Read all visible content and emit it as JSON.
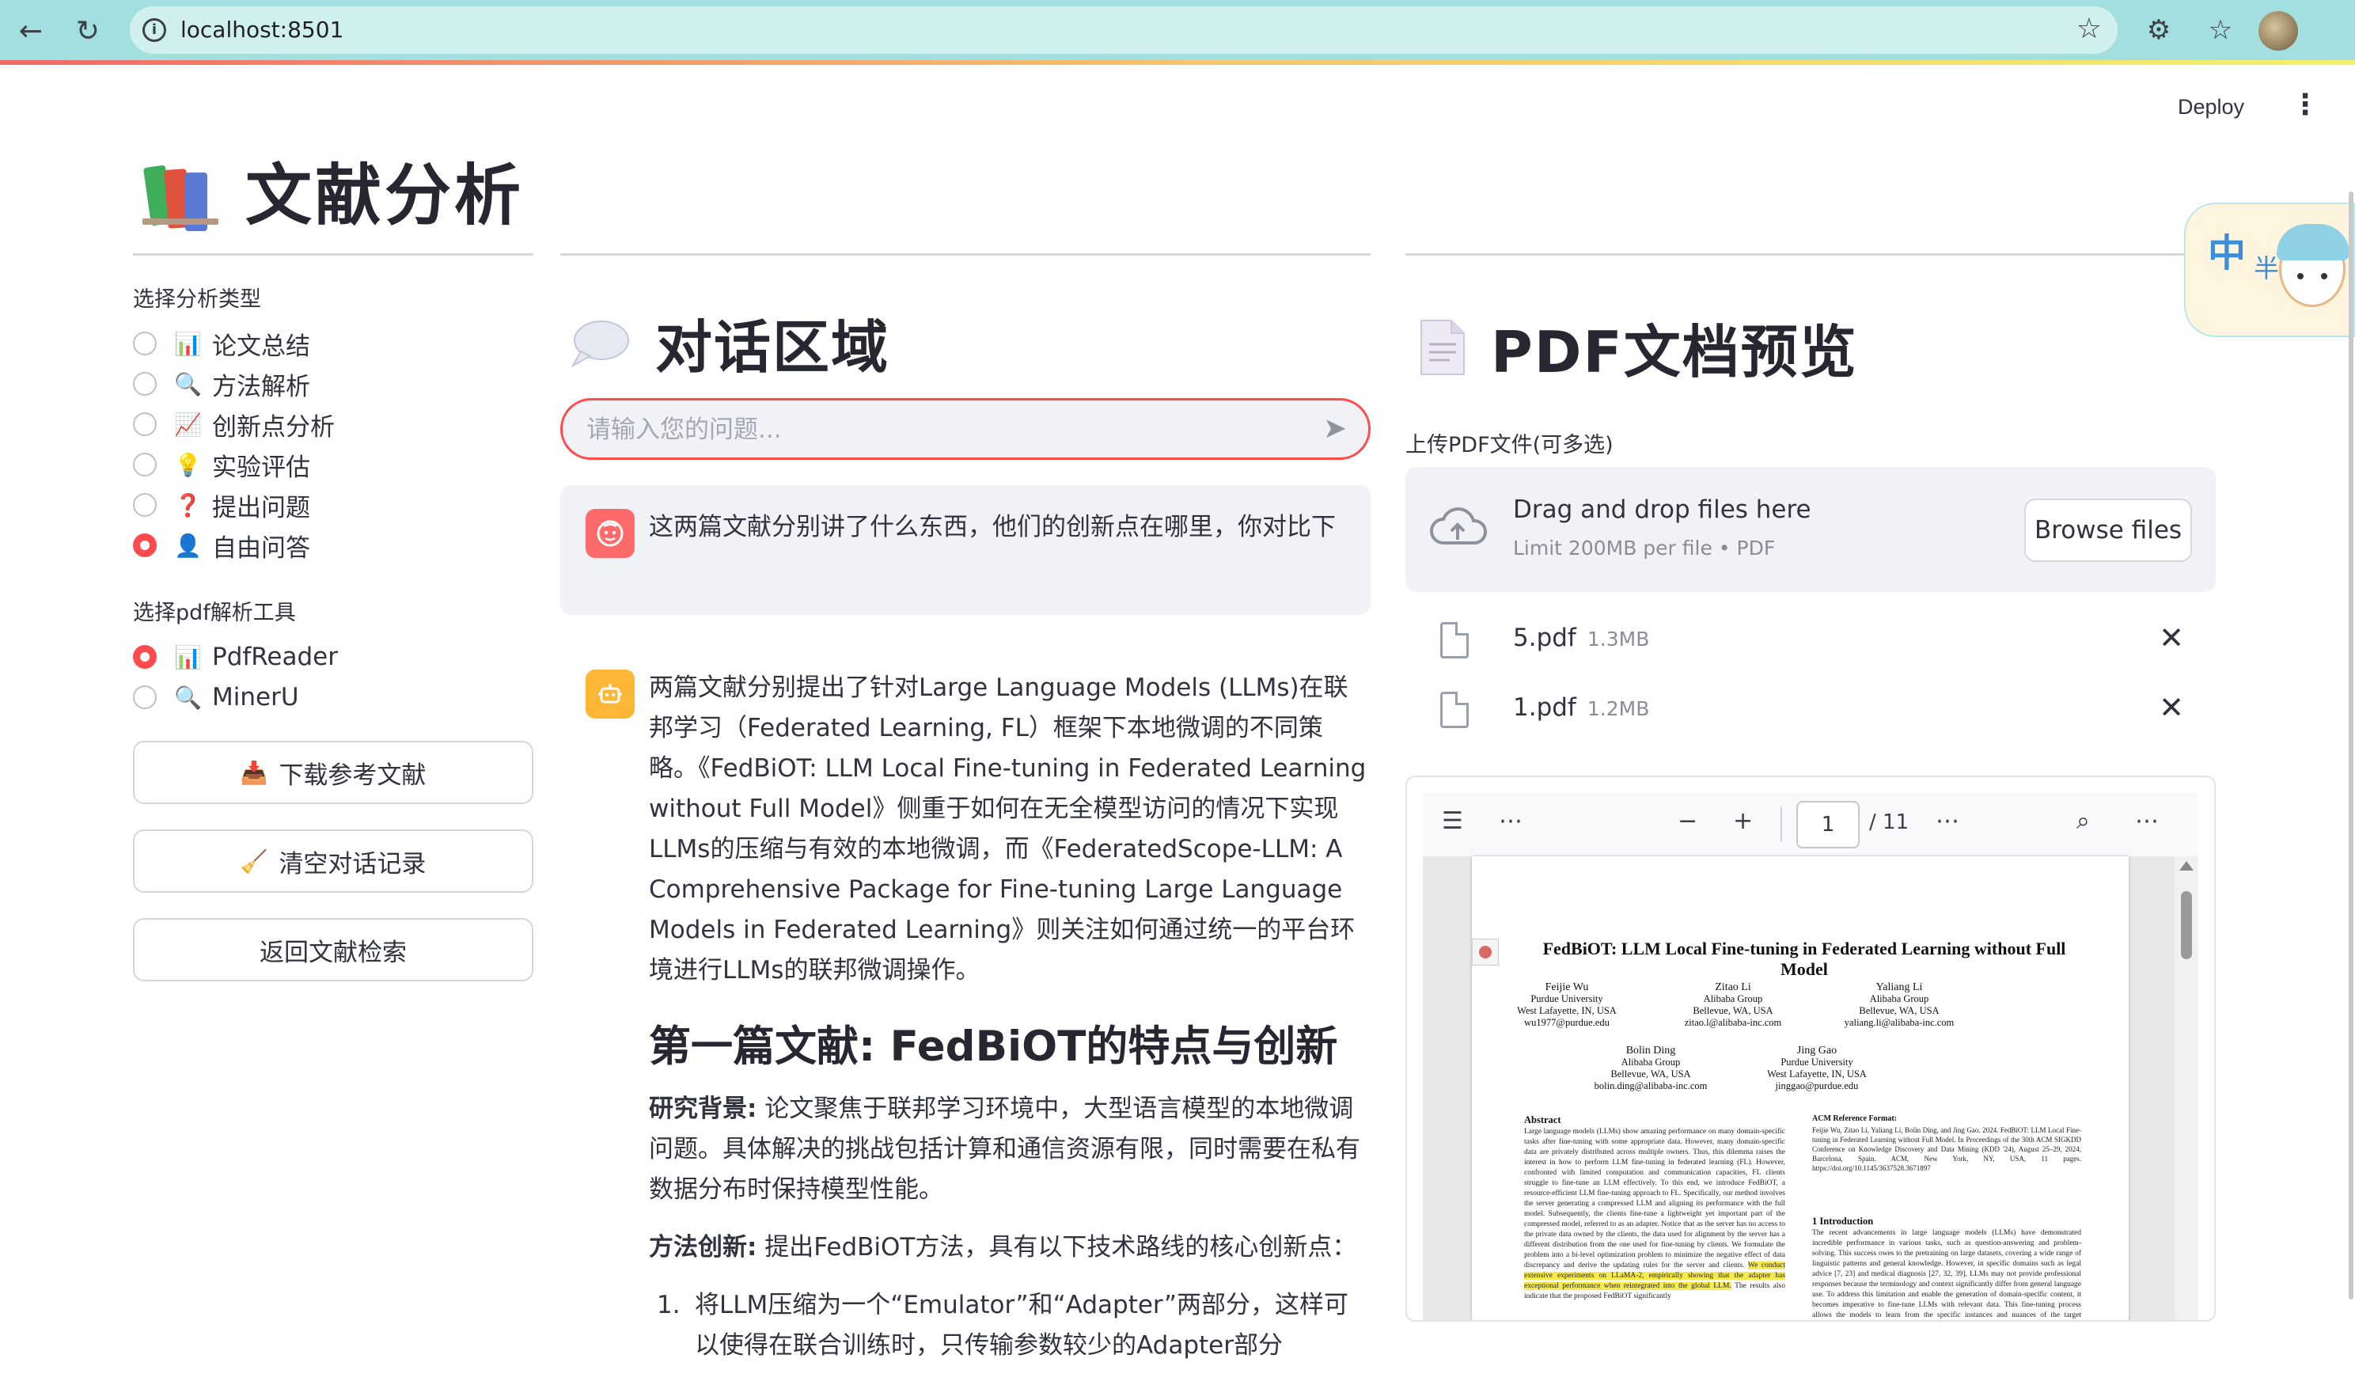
{
  "browser": {
    "url": "localhost:8501"
  },
  "app": {
    "deploy_label": "Deploy",
    "title": "文献分析"
  },
  "sidebar": {
    "analysis_label": "选择分析类型",
    "analysis_options": [
      {
        "icon": "bar-chart-icon",
        "glyph": "📊",
        "label": "论文总结",
        "selected": false
      },
      {
        "icon": "magnifier-icon",
        "glyph": "🔍",
        "label": "方法解析",
        "selected": false
      },
      {
        "icon": "trend-chart-icon",
        "glyph": "📈",
        "label": "创新点分析",
        "selected": false
      },
      {
        "icon": "lightbulb-icon",
        "glyph": "💡",
        "label": "实验评估",
        "selected": false
      },
      {
        "icon": "question-mark-icon",
        "glyph": "❓",
        "label": "提出问题",
        "selected": false
      },
      {
        "icon": "person-icon",
        "glyph": "👤",
        "label": "自由问答",
        "selected": true
      }
    ],
    "parser_label": "选择pdf解析工具",
    "parser_options": [
      {
        "icon": "bar-chart-icon",
        "glyph": "📊",
        "label": "PdfReader",
        "selected": true
      },
      {
        "icon": "magnifier-icon",
        "glyph": "🔍",
        "label": "MinerU",
        "selected": false
      }
    ],
    "buttons": {
      "download": "下载参考文献",
      "clear": "清空对话记录",
      "back": "返回文献检索"
    }
  },
  "chat": {
    "header": "对话区域",
    "input_placeholder": "请输入您的问题...",
    "user_message": "这两篇文献分别讲了什么东西，他们的创新点在哪里，你对比下",
    "bot_intro": "两篇文献分别提出了针对Large Language Models (LLMs)在联邦学习（Federated Learning, FL）框架下本地微调的不同策略。《FedBiOT: LLM Local Fine-tuning in Federated Learning without Full Model》侧重于如何在无全模型访问的情况下实现LLMs的压缩与有效的本地微调，而《FederatedScope-LLM: A Comprehensive Package for Fine-tuning Large Language Models in Federated Learning》则关注如何通过统一的平台环境进行LLMs的联邦微调操作。",
    "bot_heading": "第一篇文献: FedBiOT的特点与创新",
    "background_label": "研究背景:",
    "background_text": " 论文聚焦于联邦学习环境中，大型语言模型的本地微调问题。具体解决的挑战包括计算和通信资源有限，同时需要在私有数据分布时保持模型性能。",
    "method_label": "方法创新:",
    "method_text": " 提出FedBiOT方法，具有以下技术路线的核心创新点：",
    "list_num": "1.",
    "list_item": "将LLM压缩为一个“Emulator”和“Adapter”两部分，这样可以使得在联合训练时，只传输参数较少的Adapter部分"
  },
  "pdf": {
    "header": "PDF文档预览",
    "upload_label": "上传PDF文件(可多选)",
    "drag_title": "Drag and drop files here",
    "drag_limit": "Limit 200MB per file • PDF",
    "browse_label": "Browse files",
    "files": [
      {
        "name": "5.pdf",
        "size": "1.3MB"
      },
      {
        "name": "1.pdf",
        "size": "1.2MB"
      }
    ],
    "viewer": {
      "page": "1",
      "total": "/ 11"
    },
    "paper": {
      "title": "FedBiOT: LLM Local Fine-tuning in Federated Learning without Full Model",
      "authors": [
        {
          "name": "Feijie Wu",
          "aff": "Purdue University",
          "loc": "West Lafayette, IN, USA",
          "mail": "wu1977@purdue.edu"
        },
        {
          "name": "Zitao Li",
          "aff": "Alibaba Group",
          "loc": "Bellevue, WA, USA",
          "mail": "zitao.l@alibaba-inc.com"
        },
        {
          "name": "Yaliang Li",
          "aff": "Alibaba Group",
          "loc": "Bellevue, WA, USA",
          "mail": "yaliang.li@alibaba-inc.com"
        },
        {
          "name": "Bolin Ding",
          "aff": "Alibaba Group",
          "loc": "Bellevue, WA, USA",
          "mail": "bolin.ding@alibaba-inc.com"
        },
        {
          "name": "Jing Gao",
          "aff": "Purdue University",
          "loc": "West Lafayette, IN, USA",
          "mail": "jinggao@purdue.edu"
        }
      ],
      "abstract_title": "Abstract",
      "abstract_text": "Large language models (LLMs) show amazing performance on many domain-specific tasks after fine-tuning with some appropriate data. However, many domain-specific data are privately distributed across multiple owners. Thus, this dilemma raises the interest in how to perform LLM fine-tuning in federated learning (FL). However, confronted with limited computation and communication capacities, FL clients struggle to fine-tune an LLM effectively. To this end, we introduce FedBiOT, a resource-efficient LLM fine-tuning approach to FL. Specifically, our method involves the server generating a compressed LLM and aligning its performance with the full model. Subsequently, the clients fine-tune a lightweight yet important part of the compressed model, referred to as an adapter. Notice that as the server has no access to the private data owned by the clients, the data used for alignment by the server has a different distribution from the one used for fine-tuning by clients. We formulate the problem into a bi-level optimization problem to minimize the negative effect of data discrepancy and derive the updating rules for the server and clients.",
      "abstract_highlight": "We conduct extensive experiments on LLaMA-2, empirically showing that the adapter has exceptional performance when reintegrated into the global LLM.",
      "abstract_tail": "The results also indicate that the proposed FedBiOT significantly",
      "ref_title": "ACM Reference Format:",
      "ref_text": "Feijie Wu, Zitao Li, Yaliang Li, Bolin Ding, and Jing Gao. 2024. FedBiOT: LLM Local Fine-tuning in Federated Learning without Full Model. In Proceedings of the 30th ACM SIGKDD Conference on Knowledge Discovery and Data Mining (KDD '24), August 25–29, 2024, Barcelona, Spain. ACM, New York, NY, USA, 11 pages. https://doi.org/10.1145/3637528.3671897",
      "intro_title": "1    Introduction",
      "intro_text": "The recent advancements in large language models (LLMs) have demonstrated incredible performance in various tasks, such as question-answering and problem-solving. This success owes to the pretraining on large datasets, covering a wide range of linguistic patterns and general knowledge. However, in specific domains such as legal advice [7, 23] and medical diagnosis [27, 32, 39], LLMs may not provide professional responses because the terminology and context significantly differ from general language use. To address this limitation and enable the generation of domain-specific content, it becomes imperative to fine-tune LLMs with relevant data. This fine-tuning process allows the models to learn from the specific instances and nuances of the target application, ensuring their capability within specialized fields. The quality and quantity of the task-specific data are directly related to the performance of"
    }
  },
  "widget": {
    "text1": "中",
    "text2": "半"
  }
}
